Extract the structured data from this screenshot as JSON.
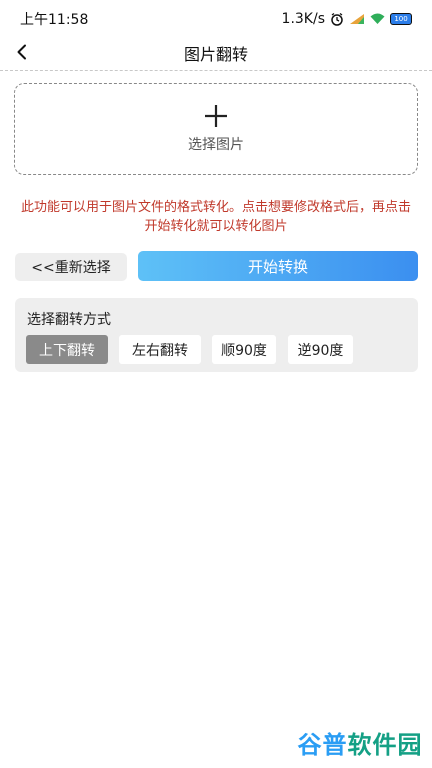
{
  "status": {
    "time": "上午11:58",
    "net_speed": "1.3K/s",
    "battery": "100"
  },
  "nav": {
    "title": "图片翻转"
  },
  "picker": {
    "label": "选择图片"
  },
  "notice": "此功能可以用于图片文件的格式转化。点击想要修改格式后，再点击开始转化就可以转化图片",
  "actions": {
    "reselect": "<<重新选择",
    "start": "开始转换"
  },
  "options": {
    "title": "选择翻转方式",
    "items": [
      {
        "label": "上下翻转",
        "selected": true
      },
      {
        "label": "左右翻转",
        "selected": false
      },
      {
        "label": "顺90度",
        "selected": false
      },
      {
        "label": "逆90度",
        "selected": false
      }
    ]
  },
  "watermark": {
    "part1": "谷普",
    "part2": "软件园"
  },
  "colors": {
    "accent_start": "#5ec1f7",
    "accent_end": "#3b8ff0",
    "notice_red": "#c0392b",
    "selected_gray": "#8a8a8a"
  }
}
